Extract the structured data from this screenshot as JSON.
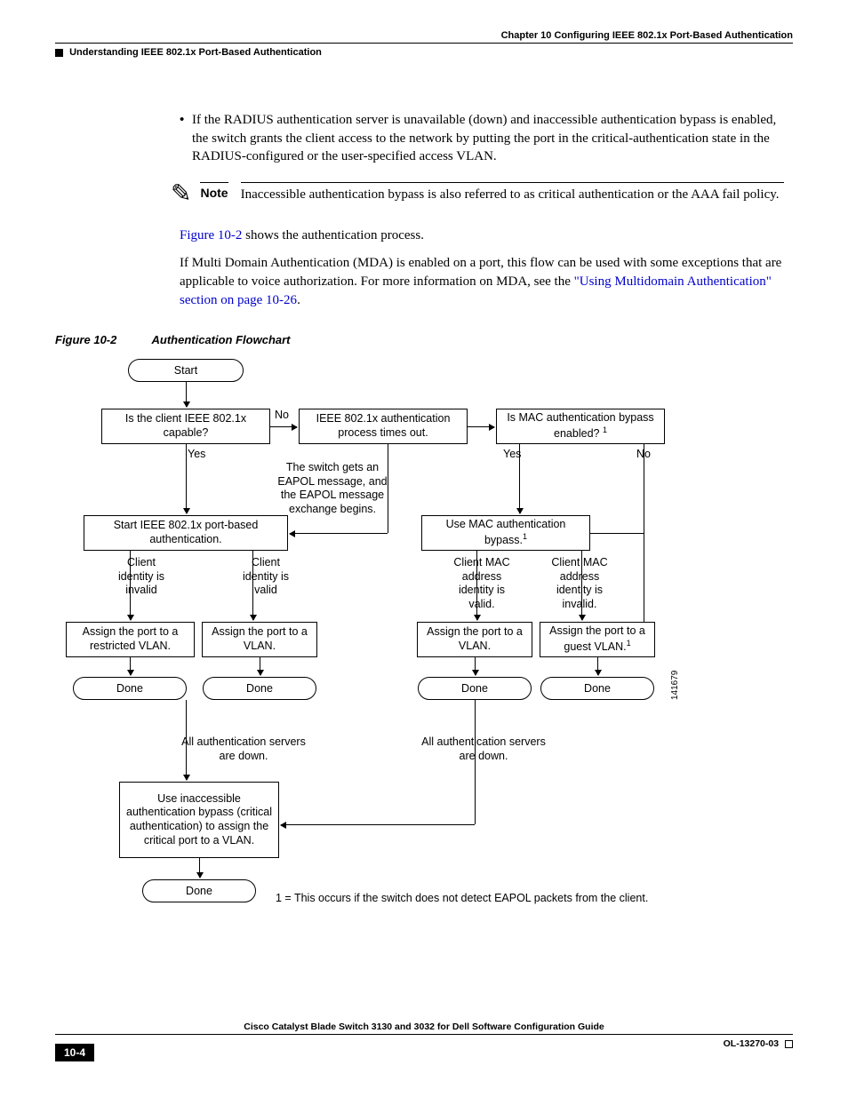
{
  "header": {
    "chapter": "Chapter 10    Configuring IEEE 802.1x Port-Based Authentication",
    "section": "Understanding IEEE 802.1x Port-Based Authentication"
  },
  "bullet": "If the RADIUS authentication server is unavailable (down) and inaccessible authentication bypass is enabled, the switch grants the client access to the network by putting the port in the critical-authentication state in the RADIUS-configured or the user-specified access VLAN.",
  "note": {
    "label": "Note",
    "text": "Inaccessible authentication bypass is also referred to as critical authentication or the AAA fail policy."
  },
  "para1_a": "Figure 10-2",
  "para1_b": " shows the authentication process.",
  "para2_a": "If Multi Domain Authentication (MDA) is enabled on a port, this flow can be used with some exceptions that are applicable to voice authorization. For more information on MDA, see the ",
  "para2_link": "\"Using Multidomain Authentication\" section on page 10-26",
  "para2_c": ".",
  "figcap": {
    "num": "Figure 10-2",
    "title": "Authentication Flowchart"
  },
  "flow": {
    "start": "Start",
    "q_client": "Is the client IEEE 802.1x capable?",
    "no": "No",
    "yes": "Yes",
    "timeout": "IEEE 802.1x authentication process times out.",
    "q_mac": "Is MAC authentication bypass enabled? ",
    "eapol": "The switch gets an EAPOL message, and the EAPOL message exchange begins.",
    "start_auth": "Start IEEE 802.1x port-based authentication.",
    "use_mac": "Use MAC authentication bypass.",
    "cli_invalid": "Client identity is invalid",
    "cli_valid": "Client identity is valid",
    "mac_valid": "Client MAC address identity is valid.",
    "mac_invalid": "Client MAC address identity is invalid.",
    "restrict": "Assign the port to a restricted VLAN.",
    "assign_vlan": "Assign the port to a VLAN.",
    "assign_vlan2": "Assign the port to a VLAN.",
    "guest": "Assign the port to a guest VLAN.",
    "done": "Done",
    "servers_down": "All authentication servers are down.",
    "critical": "Use inaccessible authentication bypass (critical authentication) to assign the critical port to a VLAN.",
    "footnote": "1 = This occurs if the switch does not detect EAPOL packets from the client.",
    "figid": "141679",
    "sup1": "1"
  },
  "footer": {
    "book": "Cisco Catalyst Blade Switch 3130 and 3032 for Dell Software Configuration Guide",
    "page": "10-4",
    "doc": "OL-13270-03"
  }
}
